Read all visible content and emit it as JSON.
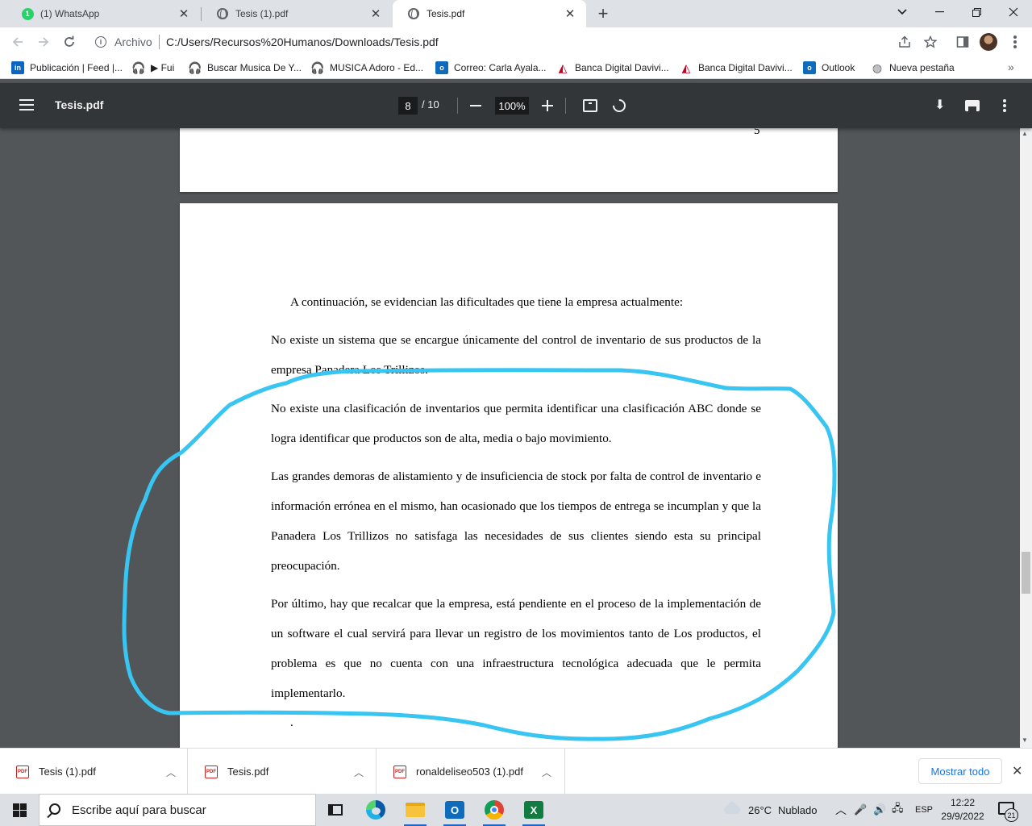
{
  "browser": {
    "tabs": [
      {
        "title": "(1) WhatsApp",
        "badge": "1",
        "icon": "whatsapp-icon",
        "active": false
      },
      {
        "title": "Tesis (1).pdf",
        "icon": "globe-icon",
        "active": false
      },
      {
        "title": "Tesis.pdf",
        "icon": "globe-icon",
        "active": true
      }
    ],
    "address": {
      "chip": "Archivo",
      "url": "C:/Users/Recursos%20Humanos/Downloads/Tesis.pdf"
    },
    "bookmarks": [
      {
        "label": "Publicación | Feed |...",
        "icon": "linkedin-icon",
        "mark": "in"
      },
      {
        "label": "▶ Fui",
        "icon": "headphones-icon"
      },
      {
        "label": "Buscar Musica De Y...",
        "icon": "headphones-icon"
      },
      {
        "label": "MUSICA Adoro - Ed...",
        "icon": "headphones-icon"
      },
      {
        "label": "Correo: Carla Ayala...",
        "icon": "outlook-icon",
        "mark": "o"
      },
      {
        "label": "Banca Digital Davivi...",
        "icon": "davivienda-icon"
      },
      {
        "label": "Banca Digital Davivi...",
        "icon": "davivienda-icon"
      },
      {
        "label": "Outlook",
        "icon": "outlook-icon",
        "mark": "o"
      },
      {
        "label": "Nueva pestaña",
        "icon": "globe-icon"
      }
    ]
  },
  "viewer": {
    "title": "Tesis.pdf",
    "page_current": "8",
    "page_total": "/ 10",
    "zoom": "100%"
  },
  "document": {
    "prev_page_number": "5",
    "paragraphs": [
      "A continuación, se evidencian las dificultades que tiene la empresa actualmente:",
      "No existe un sistema que se encargue únicamente del control de inventario de sus productos de la empresa Panadera Los Trillizos.",
      "No existe una clasificación de inventarios que permita identificar una clasificación ABC donde se logra identificar que productos son de alta, media o bajo movimiento.",
      "Las grandes demoras de alistamiento y de insuficiencia de stock por falta de control de inventario e información errónea en el mismo, han ocasionado que los tiempos de entrega se incumplan y que la Panadera Los Trillizos no satisfaga las necesidades de sus clientes siendo esta su principal preocupación.",
      "Por último, hay que recalcar que la empresa, está pendiente en el proceso de la implementación de un software el cual servirá para llevar un registro de los movimientos tanto de Los productos, el problema es que no cuenta con una infraestructura tecnológica adecuada que le permita implementarlo."
    ],
    "trailing_mark": ".",
    "annotation_color": "#38c5f2"
  },
  "downloads": {
    "items": [
      "Tesis (1).pdf",
      "Tesis.pdf",
      "ronaldeliseo503 (1).pdf"
    ],
    "show_all": "Mostrar todo"
  },
  "taskbar": {
    "search_placeholder": "Escribe aquí para buscar",
    "weather_temp": "26°C",
    "weather_text": "Nublado",
    "language": "ESP",
    "time": "12:22",
    "date": "29/9/2022",
    "notifications": "21"
  }
}
